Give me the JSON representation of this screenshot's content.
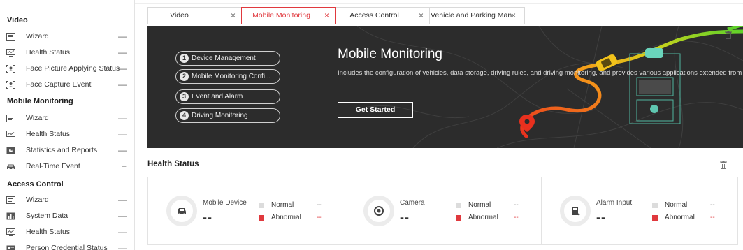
{
  "colors": {
    "accent": "#e0393e",
    "banner_bg": "#2c2c2c",
    "normal_legend": "#dcdcdc",
    "abnormal_legend": "#e0393e"
  },
  "sidebar": {
    "sections": [
      {
        "title": "Video",
        "items": [
          {
            "label": "Wizard",
            "icon": "wizard-icon",
            "toggle": "—"
          },
          {
            "label": "Health Status",
            "icon": "monitor-icon",
            "toggle": "—"
          },
          {
            "label": "Face Picture Applying Status",
            "icon": "face-scan-icon",
            "toggle": "—"
          },
          {
            "label": "Face Capture Event",
            "icon": "face-capture-icon",
            "toggle": "—"
          }
        ]
      },
      {
        "title": "Mobile Monitoring",
        "items": [
          {
            "label": "Wizard",
            "icon": "wizard-icon",
            "toggle": "—"
          },
          {
            "label": "Health Status",
            "icon": "monitor-icon",
            "toggle": "—"
          },
          {
            "label": "Statistics and Reports",
            "icon": "report-icon",
            "toggle": "—"
          },
          {
            "label": "Real-Time Event",
            "icon": "car-icon",
            "toggle": "+"
          }
        ]
      },
      {
        "title": "Access Control",
        "items": [
          {
            "label": "Wizard",
            "icon": "wizard-icon",
            "toggle": "—"
          },
          {
            "label": "System Data",
            "icon": "chart-icon",
            "toggle": "—"
          },
          {
            "label": "Health Status",
            "icon": "monitor-icon",
            "toggle": "—"
          },
          {
            "label": "Person Credential Status",
            "icon": "credential-icon",
            "toggle": "—"
          }
        ]
      }
    ]
  },
  "tabs": [
    {
      "label": "Video",
      "close": "×",
      "active": false
    },
    {
      "label": "Mobile Monitoring",
      "close": "×",
      "active": true
    },
    {
      "label": "Access Control",
      "close": "×",
      "active": false
    },
    {
      "label": "Vehicle and Parking Man...",
      "close": "×",
      "active": false
    }
  ],
  "banner": {
    "steps": [
      {
        "num": "1",
        "label": "Device Management"
      },
      {
        "num": "2",
        "label": "Mobile Monitoring Confi..."
      },
      {
        "num": "3",
        "label": "Event and Alarm"
      },
      {
        "num": "4",
        "label": "Driving Monitoring"
      }
    ],
    "title": "Mobile Monitoring",
    "description": "Includes the configuration of vehicles, data storage, driving rules, and driving monitoring, and provides various applications extended from",
    "button": "Get Started"
  },
  "health": {
    "title": "Health Status",
    "cards": [
      {
        "name": "Mobile Device",
        "value": "--",
        "icon": "vehicle-icon",
        "normal_label": "Normal",
        "normal_value": "--",
        "abnormal_label": "Abnormal",
        "abnormal_value": "--"
      },
      {
        "name": "Camera",
        "value": "--",
        "icon": "camera-icon",
        "normal_label": "Normal",
        "normal_value": "--",
        "abnormal_label": "Abnormal",
        "abnormal_value": "--"
      },
      {
        "name": "Alarm Input",
        "value": "--",
        "icon": "alarm-input-icon",
        "normal_label": "Normal",
        "normal_value": "--",
        "abnormal_label": "Abnormal",
        "abnormal_value": "--"
      }
    ]
  }
}
